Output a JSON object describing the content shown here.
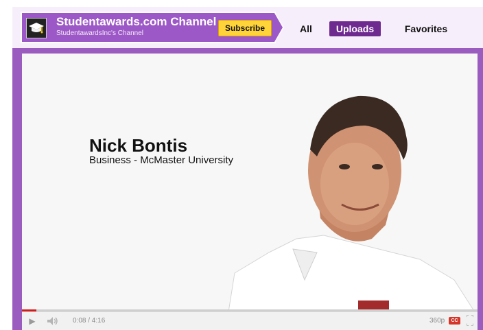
{
  "channel": {
    "title": "Studentawards.com Channel",
    "subtitle": "StudentawardsInc's Channel",
    "subscribe_label": "Subscribe",
    "avatar_icon": "graduation-cap-icon"
  },
  "tabs": [
    {
      "label": "All",
      "selected": false
    },
    {
      "label": "Uploads",
      "selected": true
    },
    {
      "label": "Favorites",
      "selected": false
    }
  ],
  "video": {
    "name_title": "Nick Bontis",
    "name_subtitle": "Business - McMaster University"
  },
  "player": {
    "time": "0:08 / 4:16",
    "quality": "360p",
    "progress_fraction": 0.031,
    "icons": [
      "play-icon",
      "volume-icon",
      "cc-icon",
      "fullscreen-icon"
    ]
  },
  "colors": {
    "frame": "#9b5cc0",
    "channel_box": "#9d58c7",
    "uploads_tab": "#6f2a90",
    "subscribe_button": "#ffd43a",
    "progress": "#d41b1b"
  }
}
